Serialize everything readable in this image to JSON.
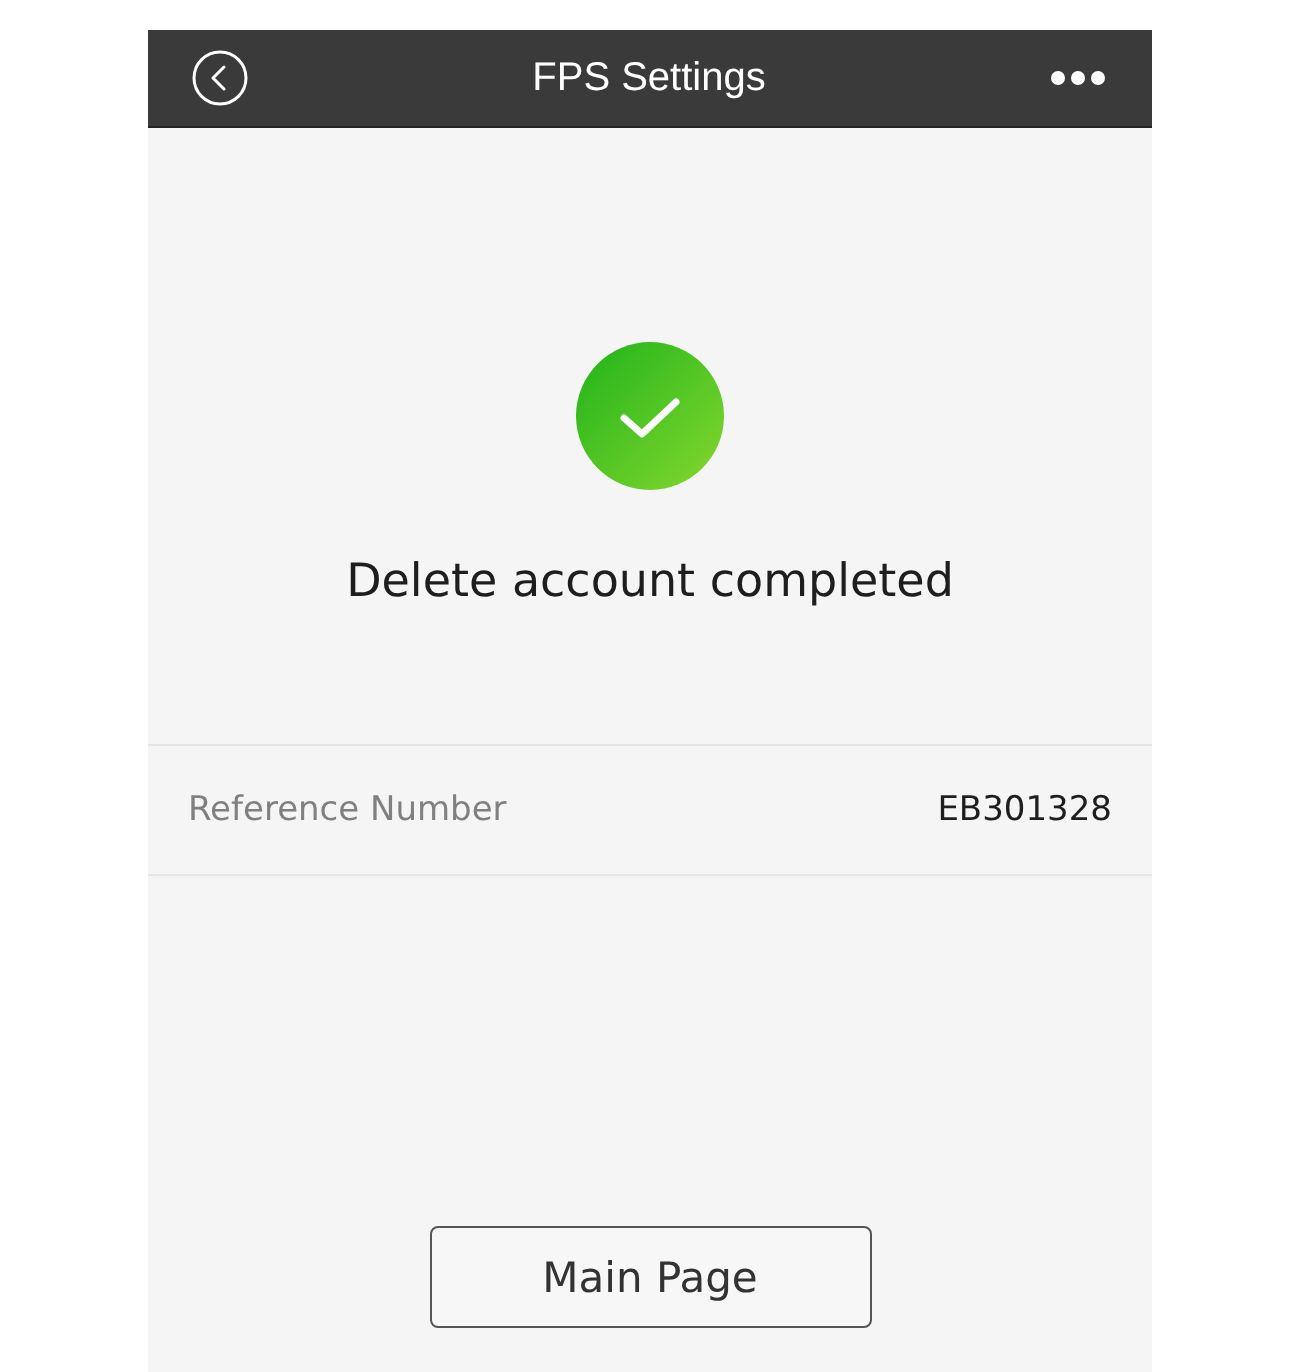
{
  "header": {
    "title": "FPS Settings"
  },
  "result": {
    "message": "Delete account completed"
  },
  "details": [
    {
      "label": "Reference Number",
      "value": "EB301328"
    }
  ],
  "buttons": [
    {
      "label": "Main Page"
    }
  ]
}
